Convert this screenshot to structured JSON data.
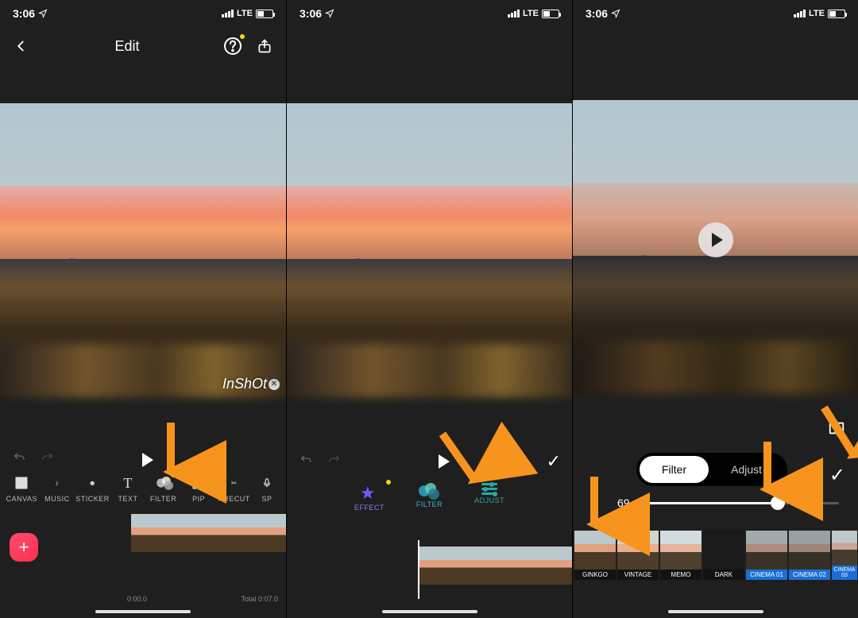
{
  "status": {
    "time": "3:06",
    "network": "LTE"
  },
  "screen1": {
    "title": "Edit",
    "watermark": "InShOt",
    "tools": [
      "CANVAS",
      "MUSIC",
      "STICKER",
      "TEXT",
      "FILTER",
      "PIP",
      "PRECUT",
      "SP"
    ],
    "time_start": "0:00.0",
    "time_total": "Total 0:07.0"
  },
  "screen2": {
    "tabs": [
      "EFFECT",
      "FILTER",
      "ADJUST"
    ],
    "active_tab": "FILTER"
  },
  "screen3": {
    "segment": {
      "filter": "Filter",
      "adjust": "Adjust",
      "active": "filter"
    },
    "slider_value": "69",
    "filters": [
      {
        "name": "GINKGO",
        "group": "n"
      },
      {
        "name": "VINTAGE",
        "group": "n"
      },
      {
        "name": "MEMO",
        "group": "n"
      },
      {
        "name": "DARK",
        "group": "dark"
      },
      {
        "name": "CINEMA 01",
        "group": "blue"
      },
      {
        "name": "CINEMA 02",
        "group": "blue"
      },
      {
        "name": "CINEMA 03",
        "group": "blue"
      }
    ]
  }
}
